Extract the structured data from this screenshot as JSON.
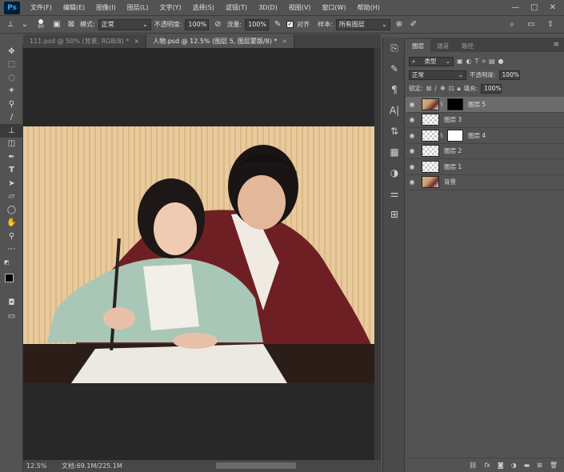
{
  "menu": {
    "logo": "Ps",
    "items": [
      "文件(F)",
      "编辑(E)",
      "图像(I)",
      "图层(L)",
      "文字(Y)",
      "选择(S)",
      "滤镜(T)",
      "3D(D)",
      "视图(V)",
      "窗口(W)",
      "帮助(H)"
    ],
    "window_buttons": [
      "—",
      "□",
      "✕"
    ]
  },
  "options": {
    "brush_size": "90",
    "mode_label": "模式:",
    "mode_value": "正常",
    "opacity_label": "不透明度:",
    "opacity_value": "100%",
    "flow_label": "流量:",
    "flow_value": "100%",
    "align_label": "对齐",
    "sample_label": "样本:",
    "sample_value": "所有图层"
  },
  "tabs": [
    {
      "label": "111.psd @ 50% (背景, RGB/8) *",
      "close": "×"
    },
    {
      "label": "人物.psd @ 12.5% (图层 5, 图层蒙版/8) *",
      "close": "×"
    }
  ],
  "status": {
    "zoom": "12.5%",
    "doc": "文档:69.1M/225.1M"
  },
  "panel": {
    "tabs": [
      "图层",
      "通道",
      "路径"
    ],
    "menu_icon": "≡",
    "filter_kind": "类型",
    "blend_mode": "正常",
    "opacity_label": "不透明度:",
    "opacity_value": "100%",
    "lock_label": "锁定:",
    "fill_label": "填充:",
    "fill_value": "100%",
    "layers": [
      {
        "name": "图层 5",
        "thumb": "photo",
        "mask": "black",
        "selected": true
      },
      {
        "name": "图层 3",
        "thumb": "checker",
        "mask": "",
        "selected": false
      },
      {
        "name": "图层 4",
        "thumb": "checker",
        "mask": "white",
        "selected": false
      },
      {
        "name": "图层 2",
        "thumb": "checker",
        "mask": "",
        "selected": false
      },
      {
        "name": "图层 1",
        "thumb": "checker",
        "mask": "",
        "selected": false
      },
      {
        "name": "背景",
        "thumb": "photo",
        "mask": "",
        "selected": false
      }
    ],
    "footer_fx": "fx"
  }
}
